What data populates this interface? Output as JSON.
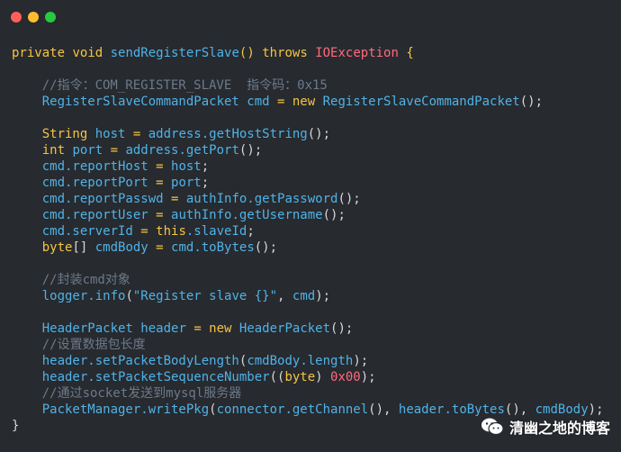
{
  "window_controls": [
    {
      "name": "close",
      "color": "#FF5F57"
    },
    {
      "name": "minimize",
      "color": "#FEBC2E"
    },
    {
      "name": "maximize",
      "color": "#28C840"
    }
  ],
  "code": {
    "lines": [
      [
        {
          "t": "private ",
          "c": "kw"
        },
        {
          "t": "void ",
          "c": "kw"
        },
        {
          "t": "sendRegisterSlave",
          "c": "cls"
        },
        {
          "t": "() ",
          "c": "kw"
        },
        {
          "t": "throws ",
          "c": "kw"
        },
        {
          "t": "IOException",
          "c": "var"
        },
        {
          "t": " {",
          "c": "kw"
        }
      ],
      [],
      [
        {
          "t": "    //指令：COM_REGISTER_SLAVE  指令码：0x15",
          "c": "cm"
        }
      ],
      [
        {
          "t": "    RegisterSlaveCommandPacket cmd ",
          "c": "cls"
        },
        {
          "t": "= ",
          "c": "kw"
        },
        {
          "t": "new ",
          "c": "kw"
        },
        {
          "t": "RegisterSlaveCommandPacket",
          "c": "cls"
        },
        {
          "t": "();",
          "c": "plain"
        }
      ],
      [],
      [
        {
          "t": "    String ",
          "c": "kw"
        },
        {
          "t": "host ",
          "c": "cls"
        },
        {
          "t": "= ",
          "c": "kw"
        },
        {
          "t": "address.getHostString",
          "c": "cls"
        },
        {
          "t": "();",
          "c": "plain"
        }
      ],
      [
        {
          "t": "    int ",
          "c": "kw"
        },
        {
          "t": "port ",
          "c": "cls"
        },
        {
          "t": "= ",
          "c": "kw"
        },
        {
          "t": "address.getPort",
          "c": "cls"
        },
        {
          "t": "();",
          "c": "plain"
        }
      ],
      [
        {
          "t": "    cmd.reportHost ",
          "c": "cls"
        },
        {
          "t": "= ",
          "c": "kw"
        },
        {
          "t": "host",
          "c": "cls"
        },
        {
          "t": ";",
          "c": "plain"
        }
      ],
      [
        {
          "t": "    cmd.reportPort ",
          "c": "cls"
        },
        {
          "t": "= ",
          "c": "kw"
        },
        {
          "t": "port",
          "c": "cls"
        },
        {
          "t": ";",
          "c": "plain"
        }
      ],
      [
        {
          "t": "    cmd.reportPasswd ",
          "c": "cls"
        },
        {
          "t": "= ",
          "c": "kw"
        },
        {
          "t": "authInfo.getPassword",
          "c": "cls"
        },
        {
          "t": "();",
          "c": "plain"
        }
      ],
      [
        {
          "t": "    cmd.reportUser ",
          "c": "cls"
        },
        {
          "t": "= ",
          "c": "kw"
        },
        {
          "t": "authInfo.getUsername",
          "c": "cls"
        },
        {
          "t": "();",
          "c": "plain"
        }
      ],
      [
        {
          "t": "    cmd.serverId ",
          "c": "cls"
        },
        {
          "t": "= ",
          "c": "kw"
        },
        {
          "t": "this",
          "c": "kw"
        },
        {
          "t": ".slaveId",
          "c": "cls"
        },
        {
          "t": ";",
          "c": "plain"
        }
      ],
      [
        {
          "t": "    byte",
          "c": "kw"
        },
        {
          "t": "[] ",
          "c": "plain"
        },
        {
          "t": "cmdBody ",
          "c": "cls"
        },
        {
          "t": "= ",
          "c": "kw"
        },
        {
          "t": "cmd.toBytes",
          "c": "cls"
        },
        {
          "t": "();",
          "c": "plain"
        }
      ],
      [],
      [
        {
          "t": "    //封装cmd对象",
          "c": "cm"
        }
      ],
      [
        {
          "t": "    logger.info",
          "c": "cls"
        },
        {
          "t": "(",
          "c": "plain"
        },
        {
          "t": "\"Register slave {}\"",
          "c": "str"
        },
        {
          "t": ", ",
          "c": "plain"
        },
        {
          "t": "cmd",
          "c": "cls"
        },
        {
          "t": ");",
          "c": "plain"
        }
      ],
      [],
      [
        {
          "t": "    HeaderPacket ",
          "c": "cls"
        },
        {
          "t": "header ",
          "c": "cls"
        },
        {
          "t": "= ",
          "c": "kw"
        },
        {
          "t": "new ",
          "c": "kw"
        },
        {
          "t": "HeaderPacket",
          "c": "cls"
        },
        {
          "t": "();",
          "c": "plain"
        }
      ],
      [
        {
          "t": "    //设置数据包长度",
          "c": "cm"
        }
      ],
      [
        {
          "t": "    header.setPacketBodyLength",
          "c": "cls"
        },
        {
          "t": "(",
          "c": "plain"
        },
        {
          "t": "cmdBody.length",
          "c": "cls"
        },
        {
          "t": ");",
          "c": "plain"
        }
      ],
      [
        {
          "t": "    header.setPacketSequenceNumber",
          "c": "cls"
        },
        {
          "t": "((",
          "c": "plain"
        },
        {
          "t": "byte",
          "c": "kw"
        },
        {
          "t": ") ",
          "c": "plain"
        },
        {
          "t": "0x00",
          "c": "num"
        },
        {
          "t": ");",
          "c": "plain"
        }
      ],
      [
        {
          "t": "    //通过socket发送到mysql服务器",
          "c": "cm"
        }
      ],
      [
        {
          "t": "    PacketManager.writePkg",
          "c": "cls"
        },
        {
          "t": "(",
          "c": "plain"
        },
        {
          "t": "connector.getChannel",
          "c": "cls"
        },
        {
          "t": "(), ",
          "c": "plain"
        },
        {
          "t": "header.toBytes",
          "c": "cls"
        },
        {
          "t": "(), ",
          "c": "plain"
        },
        {
          "t": "cmdBody",
          "c": "cls"
        },
        {
          "t": ");",
          "c": "plain"
        }
      ],
      [
        {
          "t": "}",
          "c": "plain"
        }
      ]
    ]
  },
  "watermark": {
    "text": "清幽之地的博客",
    "icon": "wechat-icon"
  }
}
